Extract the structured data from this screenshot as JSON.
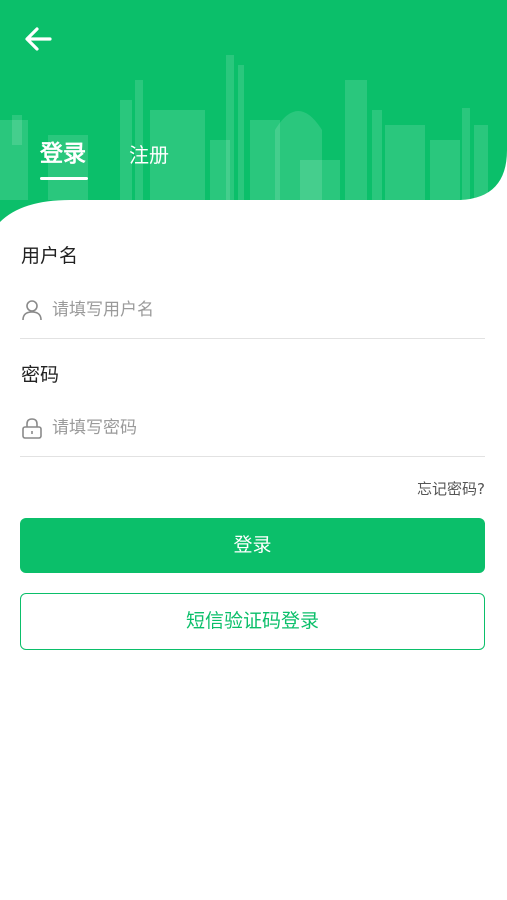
{
  "header": {
    "tabs": [
      {
        "label": "登录",
        "active": true
      },
      {
        "label": "注册",
        "active": false
      }
    ]
  },
  "form": {
    "username": {
      "label": "用户名",
      "placeholder": "请填写用户名",
      "value": ""
    },
    "password": {
      "label": "密码",
      "placeholder": "请填写密码",
      "value": ""
    },
    "forgot_label": "忘记密码?"
  },
  "actions": {
    "login_label": "登录",
    "sms_login_label": "短信验证码登录"
  },
  "colors": {
    "accent": "#0bbf6a",
    "header_bg": "#0bbf6a"
  },
  "icons": {
    "back": "arrow-left-icon",
    "user": "user-icon",
    "lock": "lock-icon"
  }
}
